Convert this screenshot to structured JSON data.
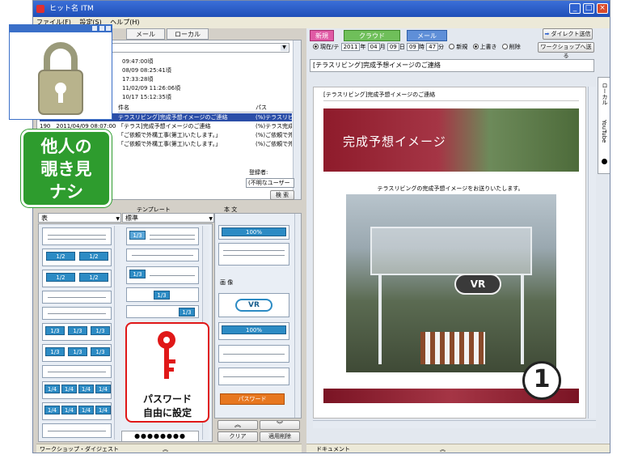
{
  "window": {
    "title": "ヒット名 ITM",
    "menu": [
      "ファイル(F)",
      "設定(S)",
      "ヘルプ(H)"
    ]
  },
  "left_tabs": [
    "メール",
    "ローカル"
  ],
  "list_rows": [
    "09:47:00頃",
    "08/09 08:25:41頃",
    "17:33:28頃",
    "11/02/09 11:26:06頃",
    "10/17 15:12:35頃"
  ],
  "table": {
    "headers": [
      "件名",
      "パス"
    ],
    "rows": [
      {
        "date": "",
        "subject": "テラスリビング]完成予想イメージのご連絡",
        "path": "(%)テラスリビン"
      },
      {
        "date": "190　2011/04/09 08:07:00",
        "subject": "「テラス]完成予想イメージのご連絡",
        "path": "(%)テラス完成"
      },
      {
        "date": "",
        "subject": "「ご依頼で外構工事(第工)いたします。」",
        "path": "(%)ご依頼で外構工"
      },
      {
        "date": "",
        "subject": "「ご依頼で外構工事(第工)いたします。」",
        "path": "(%)ご依頼で外構工"
      }
    ]
  },
  "user": {
    "label": "登録者:",
    "value": "(不明なユーザー",
    "search_button": "検 索"
  },
  "template_panel": {
    "heading": "テンプレート",
    "select_left": "表",
    "select_mid": "標準",
    "chips_half": [
      "1/2",
      "1/2"
    ],
    "chips_third": [
      "1/3",
      "1/3",
      "1/3"
    ],
    "chips_quarter": [
      "1/4",
      "1/4",
      "1/4",
      "1/4"
    ],
    "mid_chip": "1/3",
    "parts_heading": "本 文",
    "parts_100": "100%",
    "parts_vr": "VR",
    "parts_bg": "画 像",
    "password_chip": "パスワード",
    "clear_button": "クリア",
    "apply_button": "適用削除"
  },
  "bottom_status": {
    "left": "ワークショップ・ダイジェスト",
    "right": "ドキュメント"
  },
  "right_toolbar": {
    "tab_new": "新規",
    "tab_cloud": "クラウド",
    "tab_mail": "メール",
    "send_button": "ダイレクト送信",
    "date_label": "現在/テ",
    "date_year": "2011",
    "date_month": "04",
    "date_day": "09",
    "date_hour": "09",
    "date_min": "47",
    "label_year": "年",
    "label_month": "月",
    "label_day": "日",
    "label_hour": "時",
    "label_min": "分",
    "radio_new": "新規",
    "radio_overwrite": "上書き",
    "radio_delete": "削除",
    "workshop_button": "ワークショップへ送る"
  },
  "subject_field": "[テラスリビング]完成予想イメージのご連絡",
  "side_tabs": [
    "ローカル",
    "YouTube"
  ],
  "document": {
    "header_text": "[テラスリビング]完成予想イメージのご連絡",
    "banner_text": "完成予想イメージ",
    "caption": "テラスリビングの完成予想イメージをお送りいたします。",
    "vr_label": "VR",
    "number_badge": "1"
  },
  "overlays": {
    "privacy_text_line1": "他人の",
    "privacy_text_line2": "覗き見",
    "privacy_text_line3": "ナシ",
    "password_line1": "パスワード",
    "password_line2": "自由に設定",
    "password_dots": "●●●●●●●●"
  },
  "colors": {
    "accent_green": "#2e9c2e",
    "chip_blue": "#2c8bc4",
    "banner_red": "#8e1b2b",
    "key_red": "#e01818",
    "password_orange": "#e7771f"
  }
}
